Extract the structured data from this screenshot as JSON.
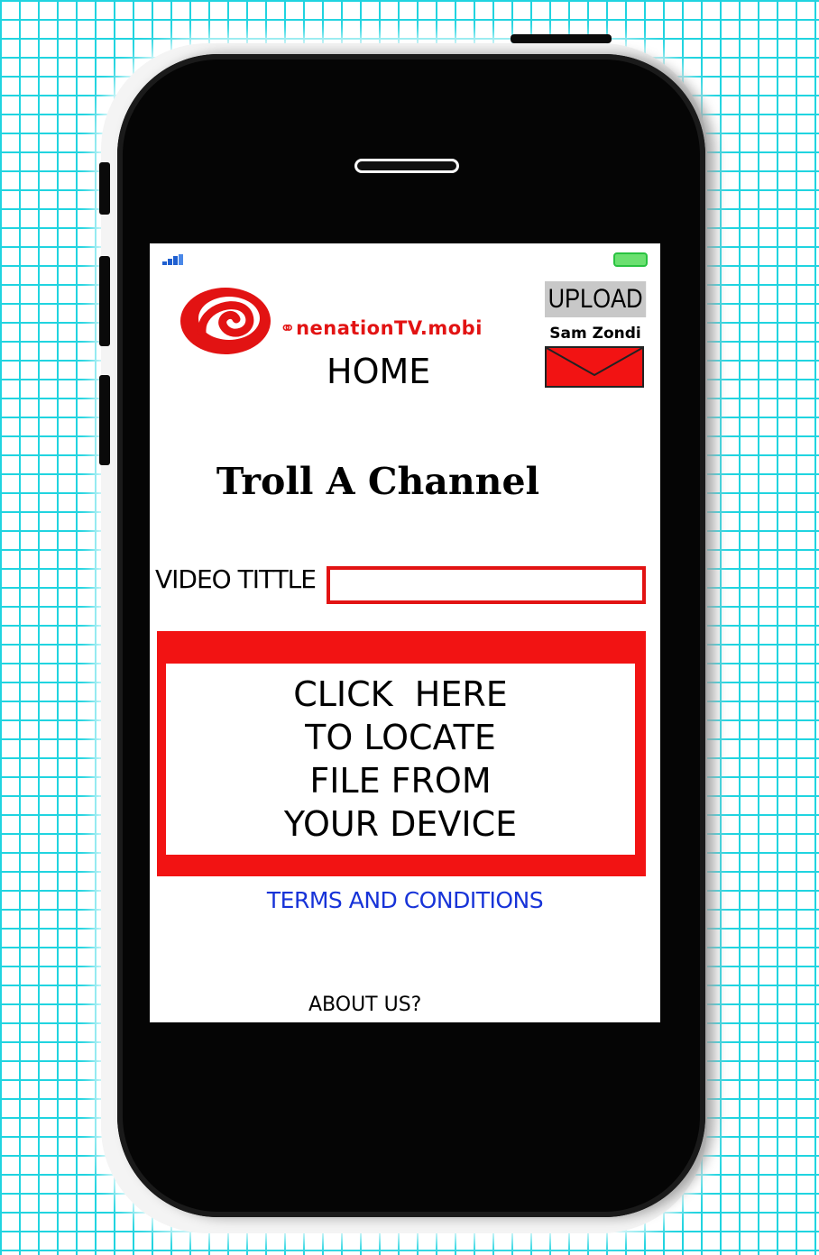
{
  "status_bar": {
    "signal_icon": "signal-bars-icon",
    "battery_icon": "battery-icon"
  },
  "header": {
    "brand": "⚭nenationTV.mobi",
    "page_title": "HOME",
    "upload_label": "UPLOAD",
    "username": "Sam Zondi",
    "mail_icon": "envelope-icon"
  },
  "main": {
    "heading": "Troll A Channel",
    "video_title_label": "VIDEO TITTLE",
    "video_title_value": "",
    "locate_lines": [
      "CLICK  HERE",
      "TO LOCATE",
      "FILE FROM",
      "YOUR DEVICE"
    ]
  },
  "footer": {
    "terms_label": "TERMS AND CONDITIONS",
    "about_label": "ABOUT US?"
  },
  "colors": {
    "brand_red": "#e21313",
    "link_blue": "#1733d8",
    "grid_cyan": "#20d4e0"
  }
}
